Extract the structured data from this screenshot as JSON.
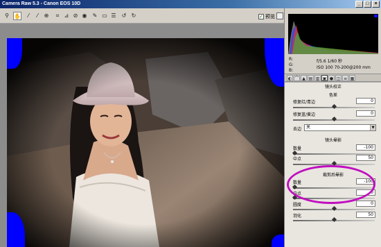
{
  "window": {
    "title": "Camera Raw 5.3  -  Canon EOS 10D"
  },
  "toolbar": {
    "tools": [
      "zoom-icon",
      "hand-icon",
      "white-balance-icon",
      "color-sampler-icon",
      "target-adjust-icon",
      "crop-icon",
      "straighten-icon",
      "spot-removal-icon",
      "red-eye-icon",
      "adjustment-brush-icon",
      "graduated-filter-icon",
      "preferences-icon",
      "rotate-left-icon",
      "rotate-right-icon"
    ],
    "preview_label": "预览",
    "preview_checked": true
  },
  "camera_info": {
    "rgb_labels": [
      "R:",
      "G:",
      "B:"
    ],
    "exposure": "f/5.6   1/60 秒",
    "iso_lens": "ISO 100    70-200@200 mm"
  },
  "panel": {
    "tab_title": "镜头校正",
    "tab_icons": [
      "histogram-tab-icon",
      "tone-curve-tab-icon",
      "detail-tab-icon",
      "hsl-tab-icon",
      "split-toning-tab-icon",
      "lens-tab-icon",
      "effects-tab-icon",
      "camera-calibration-tab-icon",
      "presets-tab-icon",
      "snapshots-tab-icon"
    ],
    "chromatic": {
      "header": "色差",
      "rows": [
        {
          "label": "修复红/青边",
          "value": "0"
        },
        {
          "label": "修复蓝/黄边",
          "value": "0"
        }
      ],
      "defringe_label": "去边",
      "defringe_value": "关"
    },
    "lens_vignette": {
      "header": "镜头晕影",
      "rows": [
        {
          "label": "数量",
          "value": "-100"
        },
        {
          "label": "中点",
          "value": "50"
        }
      ]
    },
    "post_crop": {
      "header": "裁剪后晕影",
      "rows": [
        {
          "label": "数量",
          "value": "-100"
        },
        {
          "label": "中点",
          "value": "0"
        },
        {
          "label": "圆度",
          "value": "0"
        },
        {
          "label": "羽化",
          "value": "50"
        }
      ]
    }
  },
  "colors": {
    "highlight_ellipse": "#c00fc0",
    "clipping_blue": "#0000ff"
  }
}
